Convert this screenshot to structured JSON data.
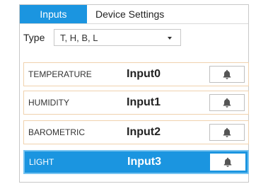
{
  "tabs": [
    {
      "label": "Inputs"
    },
    {
      "label": "Device Settings"
    }
  ],
  "type": {
    "label": "Type",
    "value": "T, H, B, L"
  },
  "rows": [
    {
      "name": "TEMPERATURE",
      "input": "Input0"
    },
    {
      "name": "HUMIDITY",
      "input": "Input1"
    },
    {
      "name": "BAROMETRIC",
      "input": "Input2"
    },
    {
      "name": "LIGHT",
      "input": "Input3"
    }
  ],
  "colors": {
    "accent": "#1b95e0",
    "row_border": "#f0d2ae",
    "bell": "#555555"
  },
  "icons": {
    "bell": "bell-icon",
    "dropdown": "chevron-down-icon"
  }
}
